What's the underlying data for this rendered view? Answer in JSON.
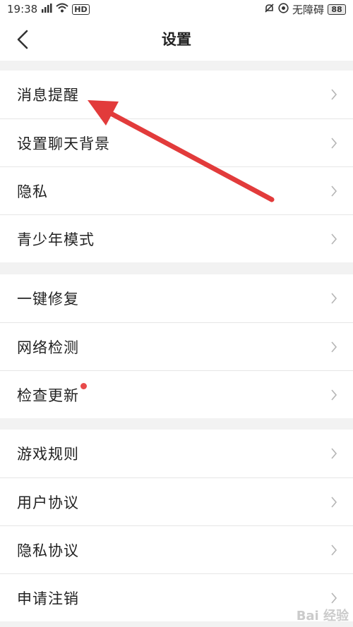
{
  "status_bar": {
    "time": "19:38",
    "signal_text": "⁵ᴳ",
    "hd_text": "HD",
    "accessibility": "无障碍",
    "battery": "88"
  },
  "header": {
    "title": "设置"
  },
  "groups": [
    [
      "消息提醒",
      "设置聊天背景",
      "隐私",
      "青少年模式"
    ],
    [
      "一键修复",
      "网络检测",
      "检查更新"
    ],
    [
      "游戏规则",
      "用户协议",
      "隐私协议",
      "申请注销"
    ]
  ],
  "badge_color": "#e84a4a",
  "annotation_arrow_color": "#e23b3b",
  "watermark": "Bai 经验"
}
